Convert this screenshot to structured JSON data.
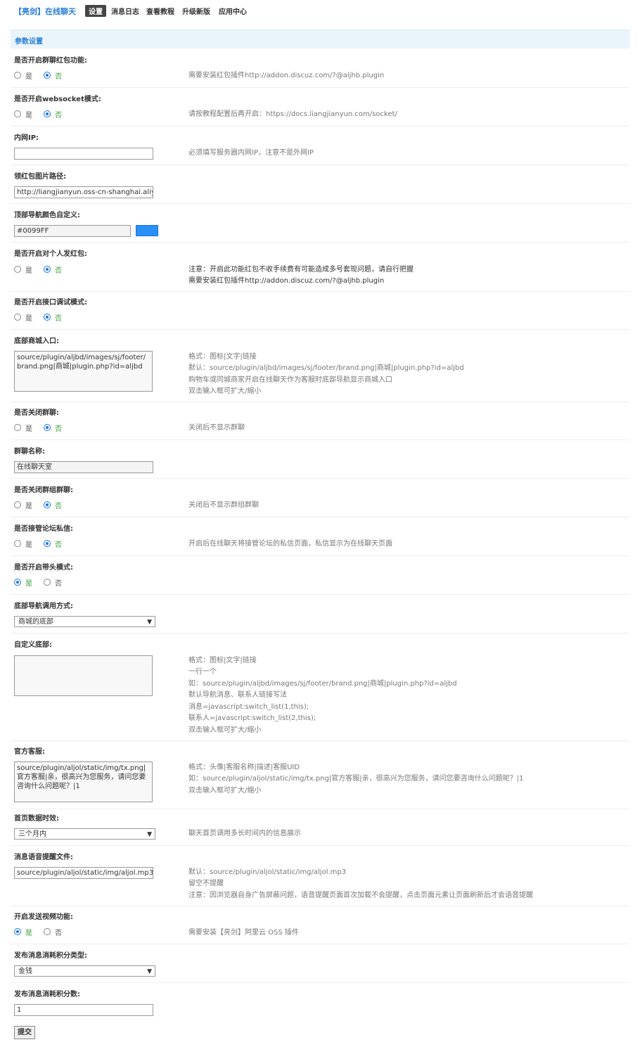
{
  "nav": {
    "brand": "【亮剑】在线聊天",
    "items": [
      "设置",
      "消息日志",
      "查看教程",
      "升级新版",
      "应用中心"
    ]
  },
  "section_title": "参数设置",
  "fields": {
    "red_packet": {
      "label": "是否开启群聊红包功能:",
      "yes": "是",
      "no": "否",
      "hint": "需要安装红包插件http://addon.discuz.com/?@aljhb.plugin"
    },
    "websocket": {
      "label": "是否开启websocket模式:",
      "yes": "是",
      "no": "否",
      "hint": "请按教程配置后再开启：https://docs.liangjianyun.com/socket/"
    },
    "intranet_ip": {
      "label": "内网IP:",
      "value": "",
      "hint": "必须填写服务器内网IP，注意不是外网IP"
    },
    "packet_image": {
      "label": "领红包图片路径:",
      "value": "http://liangjianyun.oss-cn-shanghai.aliyu"
    },
    "nav_color": {
      "label": "顶部导航颜色自定义:",
      "value": "#0099FF",
      "swatch": "#2a90f5"
    },
    "personal_packet": {
      "label": "是否开启对个人发红包:",
      "yes": "是",
      "no": "否",
      "hint1": "注意：开启此功能红包不收手续费有可能造成多号套现问题，请自行把握",
      "hint2": "需要安装红包插件http://addon.discuz.com/?@aljhb.plugin"
    },
    "api_debug": {
      "label": "是否开启接口调试模式:",
      "yes": "是",
      "no": "否"
    },
    "footer_mall": {
      "label": "底部商城入口:",
      "value": "source/plugin/aljbd/images/sj/footer/brand.png|商城|plugin.php?id=aljbd",
      "hint_lines": [
        "格式：图标|文字|链接",
        "默认：source/plugin/aljbd/images/sj/footer/brand.png|商城|plugin.php?id=aljbd",
        "购物车或同城商家开启在线聊天作为客服时底部导航显示商城入口",
        "双击输入框可扩大/缩小"
      ]
    },
    "close_group": {
      "label": "是否关闭群聊:",
      "yes": "是",
      "no": "否",
      "hint": "关闭后不显示群聊"
    },
    "group_name": {
      "label": "群聊名称:",
      "value": "在线聊天室"
    },
    "close_group_chat": {
      "label": "是否关闭群组群聊:",
      "yes": "是",
      "no": "否",
      "hint": "关闭后不显示群组群聊"
    },
    "takeover_pm": {
      "label": "是否接管论坛私信:",
      "yes": "是",
      "no": "否",
      "hint": "开启后在线聊天将接管论坛的私信页面，私信显示为在线聊天页面"
    },
    "header_mode": {
      "label": "是否开启带头模式:",
      "yes": "是",
      "no": "否"
    },
    "footer_nav_mode": {
      "label": "底部导航调用方式:",
      "value": "商城的底部"
    },
    "custom_footer": {
      "label": "自定义底部:",
      "value": "",
      "hint_lines": [
        "格式：图标|文字|链接",
        "一行一个",
        "如：source/plugin/aljbd/images/sj/footer/brand.png|商城|plugin.php?id=aljbd",
        "默认导航消息、联系人链接写法",
        "消息=javascript:switch_list(1,this);",
        "联系人=javascript:switch_list(2,this);",
        "双击输入框可扩大/缩小"
      ]
    },
    "official_service": {
      "label": "官方客服:",
      "value": "source/plugin/aljol/static/img/tx.png|官方客服|亲，很高兴为您服务，请问您要咨询什么问题呢？|1",
      "hint_lines": [
        "格式：头像|客服名称|描述|客服UID",
        "如：source/plugin/aljol/static/img/tx.png|官方客服|亲，很高兴为您服务，请问您要咨询什么问题呢？|1",
        "双击输入框可扩大/缩小"
      ]
    },
    "home_timeliness": {
      "label": "首页数据时效:",
      "value": "三个月内",
      "hint": "聊天首页调用多长时间内的信息展示"
    },
    "voice_file": {
      "label": "消息语音提醒文件:",
      "value": "source/plugin/aljol/static/img/aljol.mp3",
      "hint_lines": [
        "默认：source/plugin/aljol/static/img/aljol.mp3",
        "留空不提醒",
        "注意：因浏览器自身广告屏蔽问题，语音提醒页面首次加载不会提醒，点击页面元素让页面刷新后才会语音提醒"
      ]
    },
    "video": {
      "label": "开启发送视频功能:",
      "yes": "是",
      "no": "否",
      "hint": "需要安装【亮剑】阿里云 OSS 插件"
    },
    "credit_type": {
      "label": "发布消息消耗积分类型:",
      "value": "金钱"
    },
    "credit_amount": {
      "label": "发布消息消耗积分数:",
      "value": "1"
    }
  },
  "submit_label": "提交"
}
